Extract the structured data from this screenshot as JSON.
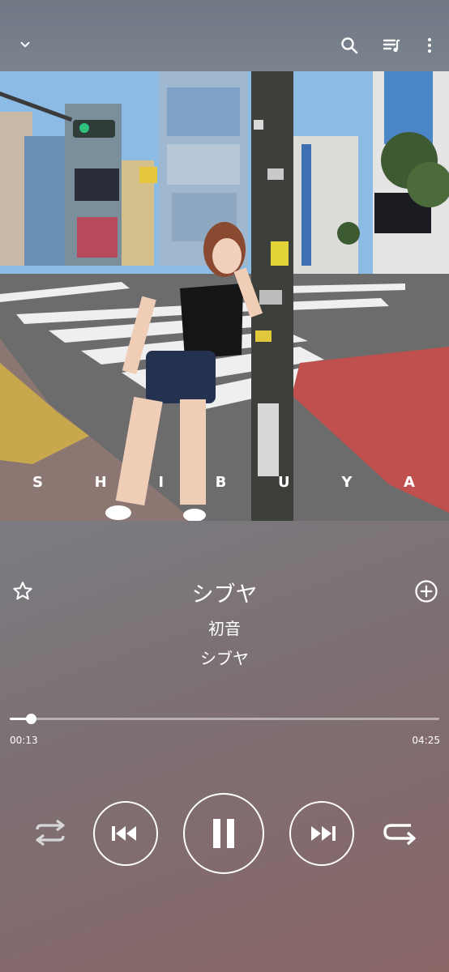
{
  "header": {
    "collapse_icon": "chevron-down-icon",
    "search_icon": "search-icon",
    "queue_icon": "queue-music-icon",
    "more_icon": "more-vert-icon"
  },
  "artwork": {
    "label_letters": [
      "S",
      "H",
      "I",
      "B",
      "U",
      "Y",
      "A"
    ]
  },
  "track": {
    "title": "シブヤ",
    "artist": "初音",
    "album": "シブヤ",
    "favorite_icon": "star-outline-icon",
    "add_icon": "add-circle-icon"
  },
  "progress": {
    "elapsed": "00:13",
    "duration": "04:25",
    "fraction": 0.049
  },
  "controls": {
    "shuffle_icon": "shuffle-icon",
    "previous_icon": "skip-previous-icon",
    "play_state_icon": "pause-icon",
    "next_icon": "skip-next-icon",
    "repeat_icon": "repeat-icon"
  },
  "colors": {
    "accent": "#ffffff",
    "crosswalk_red": "#c0504d"
  }
}
